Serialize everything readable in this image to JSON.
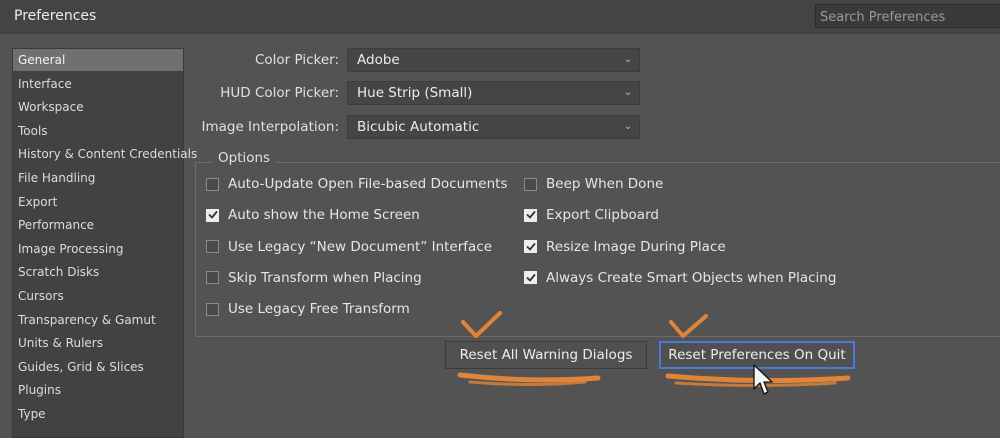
{
  "window": {
    "title": "Preferences",
    "search_placeholder": "Search Preferences"
  },
  "sidebar": {
    "items": [
      {
        "label": "General",
        "active": true
      },
      {
        "label": "Interface"
      },
      {
        "label": "Workspace"
      },
      {
        "label": "Tools"
      },
      {
        "label": "History & Content Credentials"
      },
      {
        "label": "File Handling"
      },
      {
        "label": "Export"
      },
      {
        "label": "Performance"
      },
      {
        "label": "Image Processing"
      },
      {
        "label": "Scratch Disks"
      },
      {
        "label": "Cursors"
      },
      {
        "label": "Transparency & Gamut"
      },
      {
        "label": "Units & Rulers"
      },
      {
        "label": "Guides, Grid & Slices"
      },
      {
        "label": "Plugins"
      },
      {
        "label": "Type"
      }
    ]
  },
  "general": {
    "color_picker": {
      "label": "Color Picker:",
      "value": "Adobe"
    },
    "hud_color_picker": {
      "label": "HUD Color Picker:",
      "value": "Hue Strip (Small)"
    },
    "image_interpolation": {
      "label": "Image Interpolation:",
      "value": "Bicubic Automatic"
    }
  },
  "options": {
    "legend": "Options",
    "left": [
      {
        "label": "Auto-Update Open File-based Documents",
        "checked": false
      },
      {
        "label": "Auto show the Home Screen",
        "checked": true
      },
      {
        "label": "Use Legacy “New Document” Interface",
        "checked": false
      },
      {
        "label": "Skip Transform when Placing",
        "checked": false
      },
      {
        "label": "Use Legacy Free Transform",
        "checked": false
      }
    ],
    "right": [
      {
        "label": "Beep When Done",
        "checked": false
      },
      {
        "label": "Export Clipboard",
        "checked": true
      },
      {
        "label": "Resize Image During Place",
        "checked": true
      },
      {
        "label": "Always Create Smart Objects when Placing",
        "checked": true
      }
    ]
  },
  "buttons": {
    "reset_warnings": "Reset All Warning Dialogs",
    "reset_prefs": "Reset Preferences On Quit"
  },
  "colors": {
    "background": "#535353",
    "sidebar_active": "#707070",
    "focus_ring": "#4a7ad6",
    "annotation": "#e0843a"
  }
}
